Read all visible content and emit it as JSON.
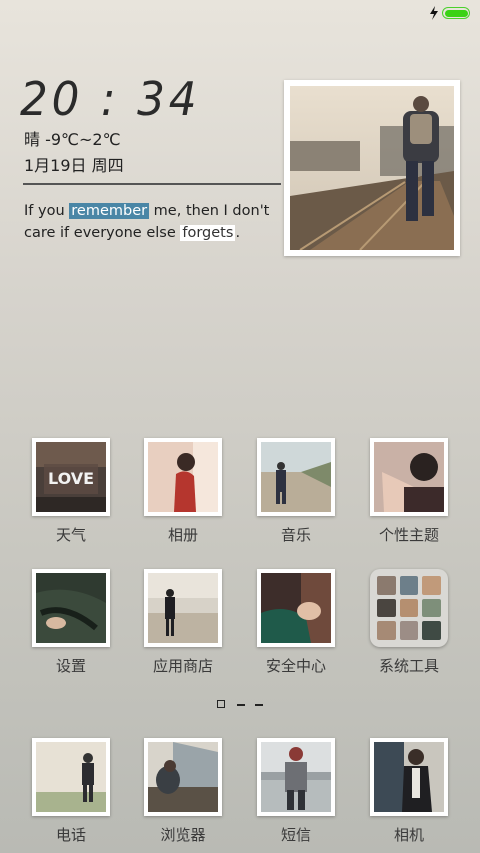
{
  "clock": {
    "time": "20 : 34"
  },
  "weather": {
    "text": "晴 -9℃~2℃"
  },
  "date": {
    "text": "1月19日 周四"
  },
  "quote": {
    "p1": "If you ",
    "h1": "remember",
    "p2": " me, then I don't care if everyone else ",
    "h2": "forgets",
    "p3": "."
  },
  "apps_row1": [
    {
      "label": "天气"
    },
    {
      "label": "相册"
    },
    {
      "label": "音乐"
    },
    {
      "label": "个性主题"
    }
  ],
  "apps_row2": [
    {
      "label": "设置"
    },
    {
      "label": "应用商店"
    },
    {
      "label": "安全中心"
    },
    {
      "label": "系统工具"
    }
  ],
  "dock": [
    {
      "label": "电话"
    },
    {
      "label": "浏览器"
    },
    {
      "label": "短信"
    },
    {
      "label": "相机"
    }
  ],
  "tile_text": {
    "love": "LOVE"
  },
  "colors": {
    "battery": "#3ad215",
    "highlight": "#4a86a6"
  }
}
